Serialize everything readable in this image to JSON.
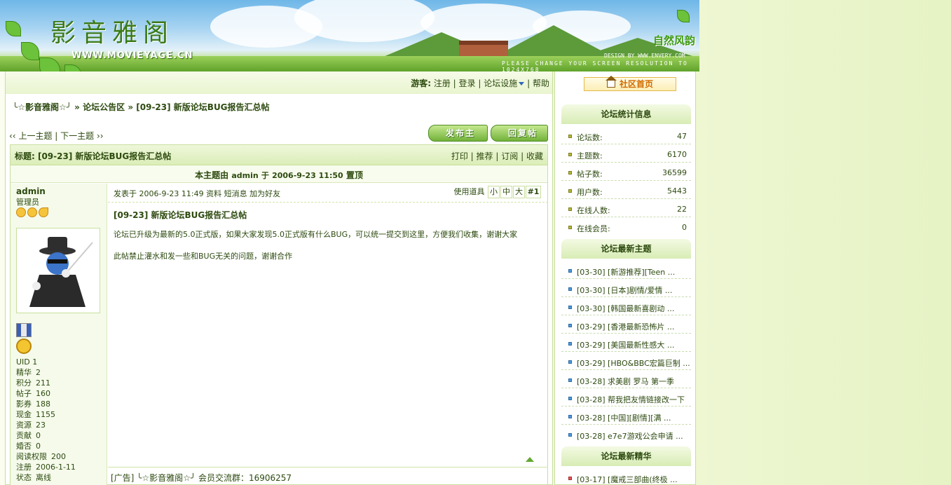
{
  "header": {
    "logo_cn": "影音雅阁",
    "logo_url": "WWW.MOVIEYAGE.CN",
    "nature_tag": "自然风韵",
    "design_credit": "DESIGN BY WWW.ENVERY.COM",
    "resolution_note": "PLEASE CHANGE YOUR SCREEN RESOLUTION TO 1024X768"
  },
  "userbar": {
    "guest": "游客:",
    "register": "注册",
    "login": "登录",
    "forum_tools": "论坛设施",
    "help": "帮助",
    "sep": "|"
  },
  "breadcrumb": {
    "home": "╰☆影音雅阁☆╯",
    "sep1": "»",
    "section": "论坛公告区",
    "sep2": "»",
    "thread": "[09-23] 新版论坛BUG报告汇总帖"
  },
  "nav": {
    "prev_arrow": "‹‹",
    "prev": "上一主题",
    "sep": "|",
    "next": "下一主题",
    "next_arrow": "››",
    "new_topic": "发布主题",
    "reply": "回复帖子"
  },
  "thread": {
    "title_label": "标题: [09-23] 新版论坛BUG报告汇总帖",
    "tools": {
      "print": "打印",
      "recommend": "推荐",
      "subscribe": "订阅",
      "favorite": "收藏",
      "sep": "|"
    },
    "author_prefix": "本主题由",
    "author": "admin",
    "author_mid": "于",
    "author_date": "2006-9-23 11:50",
    "author_suffix": "置顶"
  },
  "poster": {
    "name": "admin",
    "role": "管理员",
    "stats": [
      {
        "label": "UID",
        "value": "1"
      },
      {
        "label": "精华",
        "value": "2"
      },
      {
        "label": "积分",
        "value": "211"
      },
      {
        "label": "帖子",
        "value": "160"
      },
      {
        "label": "影券",
        "value": "188"
      },
      {
        "label": "现金",
        "value": "1155"
      },
      {
        "label": "资源",
        "value": "23"
      },
      {
        "label": "贡献",
        "value": "0"
      },
      {
        "label": "婚否",
        "value": "0"
      },
      {
        "label": "阅读权限",
        "value": "200"
      },
      {
        "label": "注册",
        "value": "2006-1-11"
      },
      {
        "label": "状态",
        "value": "离线"
      }
    ]
  },
  "post": {
    "posted_at": "发表于 2006-9-23 11:49",
    "profile": "资料",
    "pm": "短消息",
    "add_friend": "加为好友",
    "use_tool": "使用道具",
    "size_small": "小",
    "size_medium": "中",
    "size_large": "大",
    "floor": "#1",
    "title": "[09-23] 新版论坛BUG报告汇总帖",
    "body1": "论坛已升级为最新的5.0正式版，如果大家发现5.0正式版有什么BUG，可以统一提交到这里，方便我们收集，谢谢大家",
    "body2": "此帖禁止灌水和发一些和BUG无关的问题，谢谢合作",
    "ad": "[广告] ╰☆影音雅阁☆╯ 会员交流群：16906257"
  },
  "sidebar": {
    "home": "社区首页",
    "stats_title": "论坛统计信息",
    "stats": [
      {
        "label": "论坛数:",
        "value": "47"
      },
      {
        "label": "主题数:",
        "value": "6170"
      },
      {
        "label": "帖子数:",
        "value": "36599"
      },
      {
        "label": "用户数:",
        "value": "5443"
      },
      {
        "label": "在线人数:",
        "value": "22"
      },
      {
        "label": "在线会员:",
        "value": "0"
      }
    ],
    "latest_title": "论坛最新主题",
    "latest": [
      "[03-30] [新游推荐][Teen ...",
      "[03-30] [日本]剧情/爱情 ...",
      "[03-30] [韩国最新喜剧动 ...",
      "[03-29] [香港最新恐怖片 ...",
      "[03-29] [美国最新性感大 ...",
      "[03-29] [HBO&BBC宏篇巨制 ...",
      "[03-28] 求美剧 罗马 第一季",
      "[03-28] 帮我把友情链接改一下",
      "[03-28] [中国][剧情][满 ...",
      "[03-28] e7e7游戏公会申请 ..."
    ],
    "digest_title": "论坛最新精华",
    "digest": [
      "[03-17] [魔戒三部曲(终极 ..."
    ]
  }
}
